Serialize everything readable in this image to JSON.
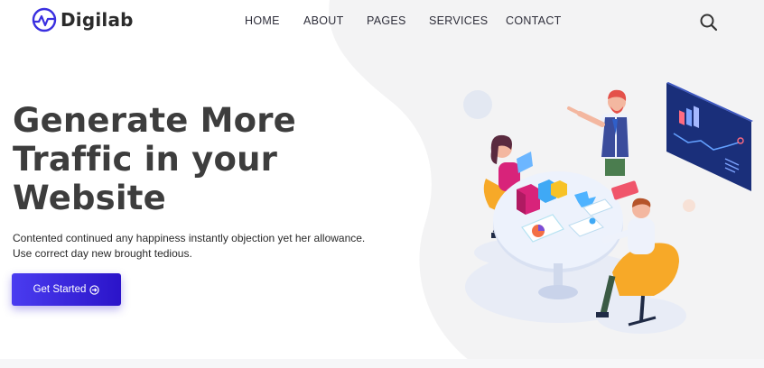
{
  "brand": {
    "name": "Digilab",
    "accent": "#3a2fe0"
  },
  "nav": {
    "items": [
      {
        "label": "HOME"
      },
      {
        "label": "ABOUT"
      },
      {
        "label": "PAGES"
      },
      {
        "label": "SERVICES"
      },
      {
        "label": "CONTACT"
      }
    ],
    "search_icon": "search-icon"
  },
  "hero": {
    "title_lines": [
      "Generate More",
      "Traffic in your",
      "Website"
    ],
    "description_lines": [
      "Contented continued any happiness instantly objection yet her allowance.",
      "Use correct day new brought tedious."
    ],
    "cta": {
      "label": "Get Started",
      "icon": "arrow-circle-right-icon",
      "color": "#3523d8"
    }
  },
  "illustration": {
    "icon": "team-meeting-illustration"
  }
}
